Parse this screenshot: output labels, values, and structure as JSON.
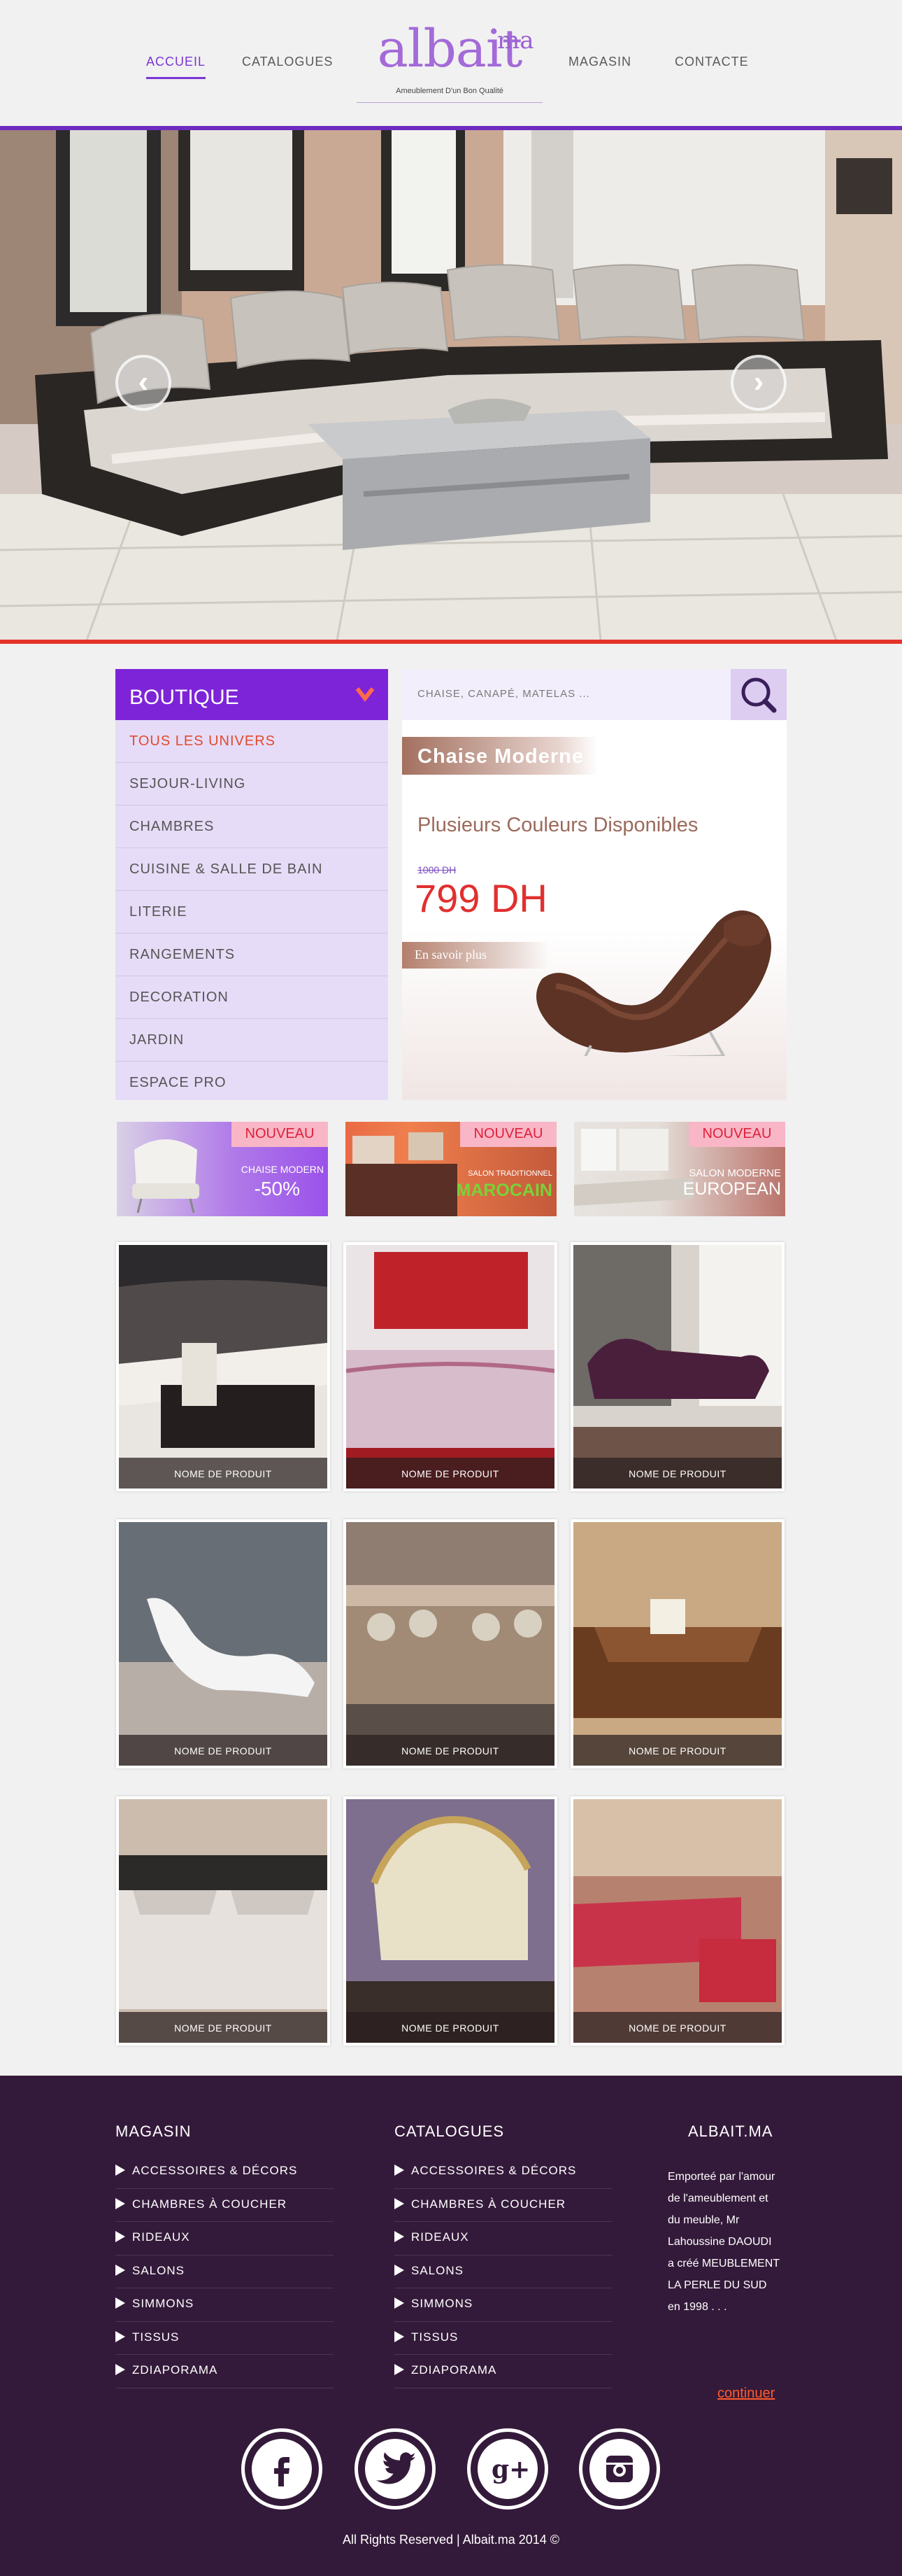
{
  "nav": {
    "accueil": "ACCUEIL",
    "catalogues": "CATALOGUES",
    "magasin": "MAGASIN",
    "contacte": "CONTACTE"
  },
  "logo": {
    "main": "albait",
    "sup": "ma",
    "tagline": "Ameublement D'un Bon Qualité"
  },
  "colors": {
    "accent": "#7e24d8",
    "price": "#e0302f",
    "footer_bg": "#341a3a",
    "link": "#ff5a2a"
  },
  "hero": {
    "prev_icon": "arrow-left-icon",
    "next_icon": "arrow-right-icon"
  },
  "boutique": {
    "title": "BOUTIQUE",
    "items": [
      "TOUS LES UNIVERS",
      "SEJOUR-LIVING",
      "CHAMBRES",
      "CUISINE & SALLE DE BAIN",
      "LITERIE",
      "RANGEMENTS",
      "DECORATION",
      "JARDIN",
      "ESPACE PRO"
    ]
  },
  "search": {
    "placeholder": "CHAISE, CANAPÉ, MATELAS ..."
  },
  "promo": {
    "title": "Chaise Moderne",
    "subtitle": "Plusieurs Couleurs Disponibles",
    "old_price": "1000 DH",
    "price": "799 DH",
    "more": "En savoir plus"
  },
  "banners": [
    {
      "badge": "NOUVEAU",
      "line1": "CHAISE MODERN",
      "line2": "-50%"
    },
    {
      "badge": "NOUVEAU",
      "line1": "SALON TRADITIONNEL",
      "line2": "MAROCAIN"
    },
    {
      "badge": "NOUVEAU",
      "line1": "SALON MODERNE",
      "line2": "EUROPEAN"
    }
  ],
  "product_label": "NOME DE PRODUIT",
  "footer": {
    "magasin_title": "MAGASIN",
    "catalogues_title": "CATALOGUES",
    "albait_title": "ALBAIT.MA",
    "links": [
      "ACCESSOIRES & DÉCORS",
      "CHAMBRES À COUCHER",
      "RIDEAUX",
      "SALONS",
      "SIMMONS",
      "TISSUS",
      "ZDIAPORAMA"
    ],
    "about": "Emporteé par l'amour de l'ameublement et du meuble, Mr Lahoussine DAOUDI a créé MEUBLEMENT LA PERLE DU SUD en 1998 . . .",
    "continue": "continuer",
    "social": [
      "facebook-icon",
      "twitter-icon",
      "google-plus-icon",
      "instagram-icon"
    ],
    "copyright": "All Rights Reserved | Albait.ma 2014 ©"
  }
}
